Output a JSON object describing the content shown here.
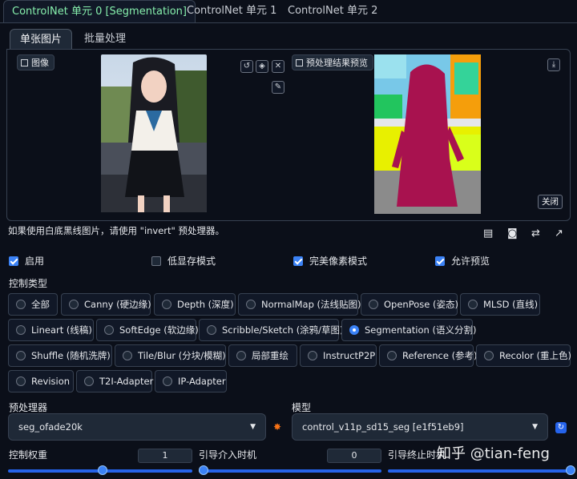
{
  "tabs": [
    "ControlNet 单元 0 [Segmentation]",
    "ControlNet 单元 1",
    "ControlNet 单元 2"
  ],
  "subtabs": [
    "单张图片",
    "批量处理"
  ],
  "image_panel": {
    "image_label": "图像",
    "preview_label": "预处理结果预览",
    "close_label": "关闭"
  },
  "hint": "如果使用白底黑线图片，请使用 \"invert\" 预处理器。",
  "checkboxes": [
    {
      "label": "启用",
      "checked": true
    },
    {
      "label": "低显存模式",
      "checked": false
    },
    {
      "label": "完美像素模式",
      "checked": true
    },
    {
      "label": "允许预览",
      "checked": true
    }
  ],
  "control_type_label": "控制类型",
  "control_types": [
    "全部",
    "Canny (硬边缘)",
    "Depth (深度)",
    "NormalMap (法线贴图)",
    "OpenPose (姿态)",
    "MLSD (直线)",
    "Lineart (线稿)",
    "SoftEdge (软边缘)",
    "Scribble/Sketch (涂鸦/草图)",
    "Segmentation (语义分割)",
    "Shuffle (随机洗牌)",
    "Tile/Blur (分块/模糊)",
    "局部重绘",
    "InstructP2P",
    "Reference (参考)",
    "Recolor (重上色)",
    "Revision",
    "T2I-Adapter",
    "IP-Adapter"
  ],
  "selected_control_type": "Segmentation (语义分割)",
  "preprocessor": {
    "label": "预处理器",
    "value": "seg_ofade20k"
  },
  "model": {
    "label": "模型",
    "value": "control_v11p_sd15_seg [e1f51eb9]"
  },
  "weight": {
    "label": "控制权重",
    "value": "1"
  },
  "start": {
    "label": "引导介入时机",
    "value": "0"
  },
  "end": {
    "label": "引导终止时机"
  },
  "watermark": "知乎 @tian-feng",
  "colors": {
    "accent": "#3b82f6",
    "active_tab": "#86efac",
    "bg": "#0b0f19"
  }
}
